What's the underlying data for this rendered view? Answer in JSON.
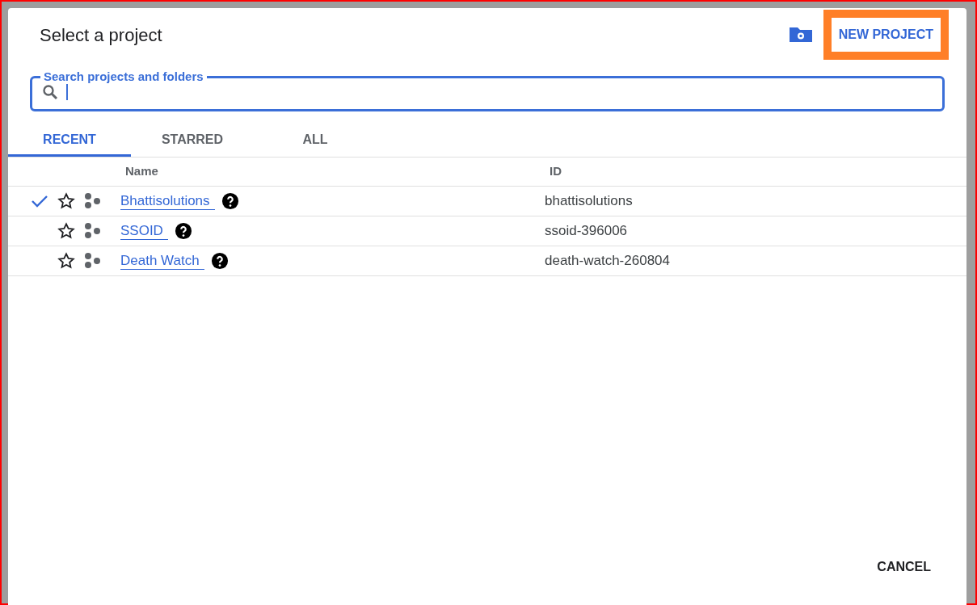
{
  "dialog": {
    "title": "Select a project",
    "new_project_button": "NEW PROJECT",
    "highlighted": true
  },
  "search": {
    "label": "Search projects and folders"
  },
  "tabs": [
    {
      "label": "RECENT",
      "selected": true
    },
    {
      "label": "STARRED",
      "selected": false
    },
    {
      "label": "ALL",
      "selected": false
    }
  ],
  "table": {
    "columns": [
      "Name",
      "ID"
    ],
    "rows": [
      {
        "name": "Bhattisolutions",
        "id": "bhattisolutions",
        "selected": true,
        "starred": false
      },
      {
        "name": "SSOID",
        "id": "ssoid-396006",
        "selected": false,
        "starred": false
      },
      {
        "name": "Death Watch",
        "id": "death-watch-260804",
        "selected": false,
        "starred": false
      }
    ]
  },
  "cancel_button": "CANCEL"
}
